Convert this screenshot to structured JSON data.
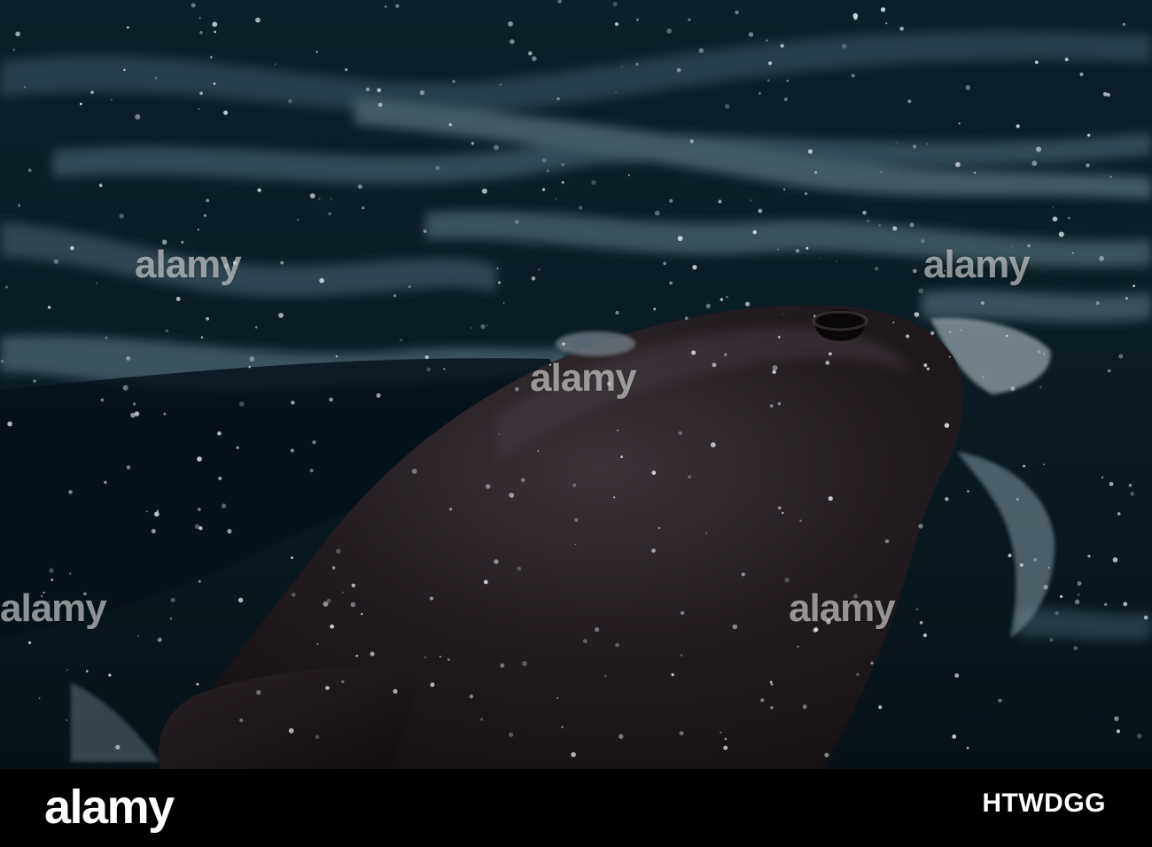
{
  "photo": {
    "subject": "whale surfacing in dark ocean water",
    "colors": {
      "water_dark": "#0b1d26",
      "water_mid": "#1b3a47",
      "water_light": "#5b7a85",
      "whale_body": "#1a1618",
      "whale_highlight": "#3a3238",
      "splash": "#d9e6ec"
    }
  },
  "watermark": {
    "text": "alamy"
  },
  "footer": {
    "logo": "alamy",
    "image_id": "HTWDGG"
  }
}
